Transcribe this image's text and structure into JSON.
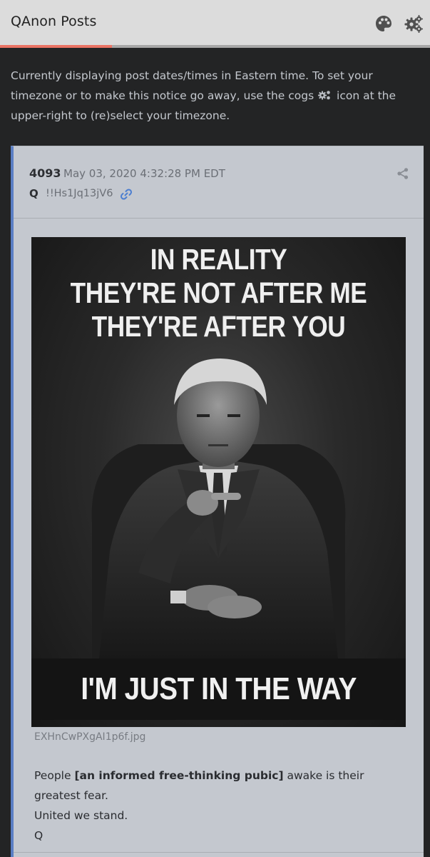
{
  "header": {
    "title": "QAnon Posts",
    "palette_icon": "palette-icon",
    "cogs_icon": "cogs-icon",
    "loading_progress": 0.26,
    "accent_color": "#ea7465"
  },
  "notice": {
    "text_before_icon": "Currently displaying post dates/times in Eastern time. To set your timezone or to make this notice go away, use the cogs ",
    "text_after_icon": " icon at the upper-right to (re)select your timezone."
  },
  "post": {
    "number": "4093",
    "date": "May 03, 2020 4:32:28 PM EDT",
    "author": "Q",
    "tripcode": "!!Hs1Jq13jV6",
    "share_icon": "share-icon",
    "link_icon": "link-icon",
    "image": {
      "top_text": [
        "IN REALITY",
        "THEY'RE NOT AFTER ME",
        "THEY'RE AFTER YOU"
      ],
      "bottom_text": "I'M JUST IN THE WAY",
      "filename": "EXHnCwPXgAI1p6f.jpg"
    },
    "body": {
      "line1_prefix": "People ",
      "line1_bold": "[an informed free-thinking pubic]",
      "line1_suffix": " awake is their greatest fear.",
      "line2": "United we stand.",
      "line3": "Q"
    }
  }
}
